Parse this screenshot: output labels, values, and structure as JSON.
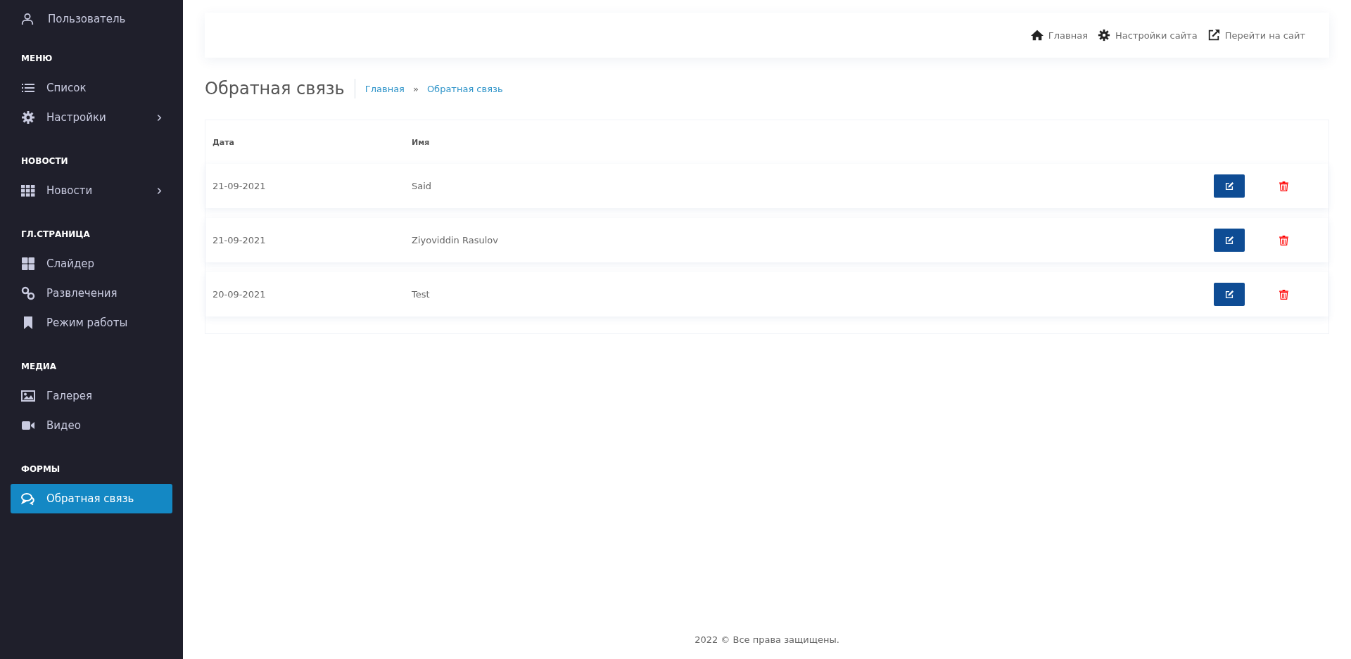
{
  "sidebar": {
    "user": "Пользователь",
    "sections": [
      {
        "heading": "МЕНЮ",
        "items": [
          {
            "label": "Список",
            "expandable": false,
            "selected": false
          },
          {
            "label": "Настройки",
            "expandable": true,
            "selected": false
          }
        ]
      },
      {
        "heading": "НОВОСТИ",
        "items": [
          {
            "label": "Новости",
            "expandable": true,
            "selected": false
          }
        ]
      },
      {
        "heading": "ГЛ.СТРАНИЦА",
        "items": [
          {
            "label": "Слайдер",
            "expandable": false,
            "selected": false
          },
          {
            "label": "Развлечения",
            "expandable": false,
            "selected": false
          },
          {
            "label": "Режим работы",
            "expandable": false,
            "selected": false
          }
        ]
      },
      {
        "heading": "МЕДИА",
        "items": [
          {
            "label": "Галерея",
            "expandable": false,
            "selected": false
          },
          {
            "label": "Видео",
            "expandable": false,
            "selected": false
          }
        ]
      },
      {
        "heading": "ФОРМЫ",
        "items": [
          {
            "label": "Обратная связь",
            "expandable": false,
            "selected": true
          }
        ]
      }
    ]
  },
  "topbar": {
    "links": [
      "Главная",
      "Настройки сайта",
      "Перейти на сайт"
    ]
  },
  "page": {
    "title": "Обратная связь",
    "breadcrumb": [
      "Главная",
      "Обратная связь"
    ],
    "breadcrumb_separator": "»"
  },
  "table": {
    "columns": [
      "Дата",
      "Имя"
    ],
    "rows": [
      {
        "date": "21-09-2021",
        "name": "Said"
      },
      {
        "date": "21-09-2021",
        "name": "Ziyoviddin Rasulov"
      },
      {
        "date": "20-09-2021",
        "name": "Test"
      }
    ]
  },
  "footer": "2022 © Все права защищены."
}
